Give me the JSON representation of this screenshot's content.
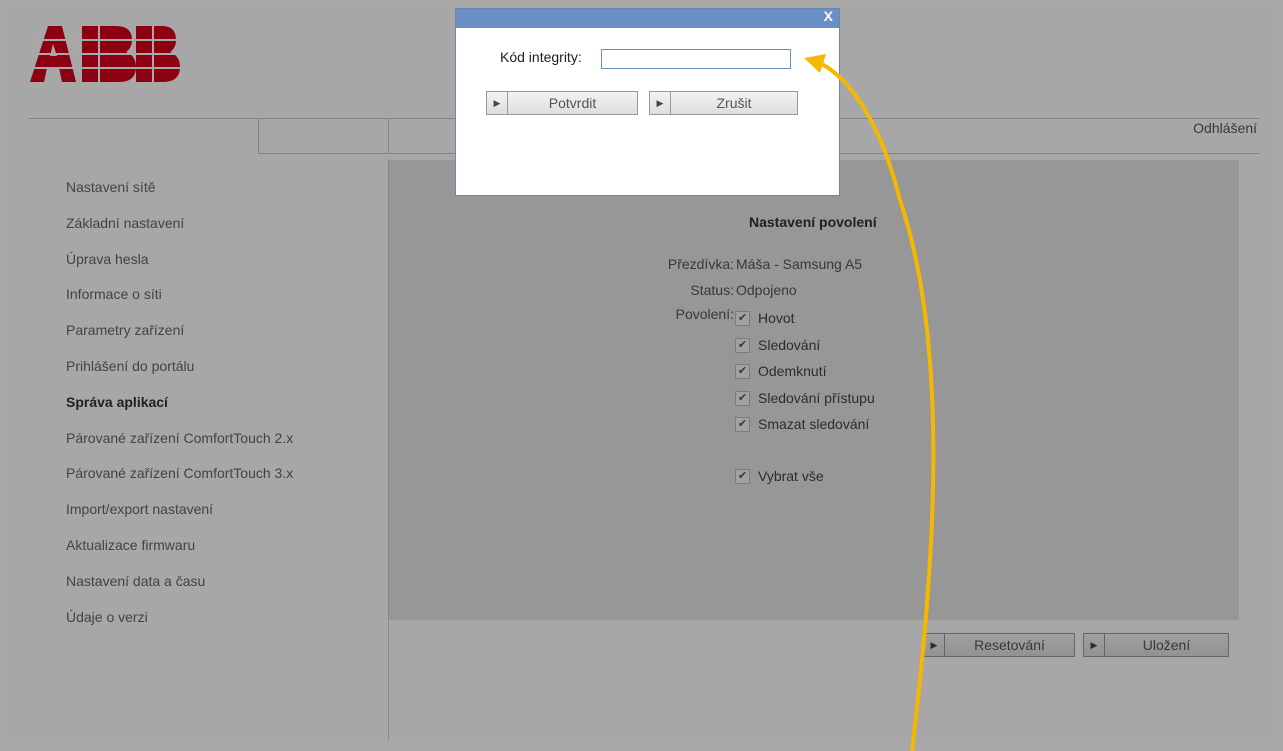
{
  "brand": {
    "logo_text": "ABB",
    "logo_color": "#d6001c"
  },
  "header": {
    "logout_label": "Odhlášení"
  },
  "sidebar": {
    "active_index": 6,
    "items": [
      {
        "label": "Nastavení sítě"
      },
      {
        "label": "Základní nastavení"
      },
      {
        "label": "Úprava hesla"
      },
      {
        "label": "Informace o síti"
      },
      {
        "label": "Parametry zařízení"
      },
      {
        "label": "Prihlášení do portálu"
      },
      {
        "label": "Správa aplikací"
      },
      {
        "label": "Párované zařízení ComfortTouch 2.x"
      },
      {
        "label": "Párované zařízení ComfortTouch 3.x"
      },
      {
        "label": "Import/export nastavení"
      },
      {
        "label": "Aktualizace firmwaru"
      },
      {
        "label": "Nastavení data a času"
      },
      {
        "label": "Údaje o verzi"
      }
    ]
  },
  "panel": {
    "title": "Nastavení povolení",
    "nickname_label": "Přezdívka:",
    "nickname_value": "Máša - Samsung A5",
    "status_label": "Status:",
    "status_value": "Odpojeno",
    "permissions_label": "Povolení:",
    "permissions": [
      {
        "label": "Hovot",
        "checked": true
      },
      {
        "label": "Sledování",
        "checked": true
      },
      {
        "label": "Odemknutí",
        "checked": true
      },
      {
        "label": "Sledování přístupu",
        "checked": true
      },
      {
        "label": "Smazat sledování",
        "checked": true
      }
    ],
    "select_all": {
      "label": "Vybrat vše",
      "checked": true
    }
  },
  "actions": {
    "reset_label": "Resetování",
    "save_label": "Uložení"
  },
  "dialog": {
    "close_label": "X",
    "field_label": "Kód integrity:",
    "field_value": "",
    "confirm_label": "Potvrdit",
    "cancel_label": "Zrušit"
  },
  "annotation": {
    "arrow_color": "#f5b800"
  },
  "colors": {
    "dialog_titlebar": "#6a8fc5",
    "content_bg": "#e6e6e6"
  }
}
